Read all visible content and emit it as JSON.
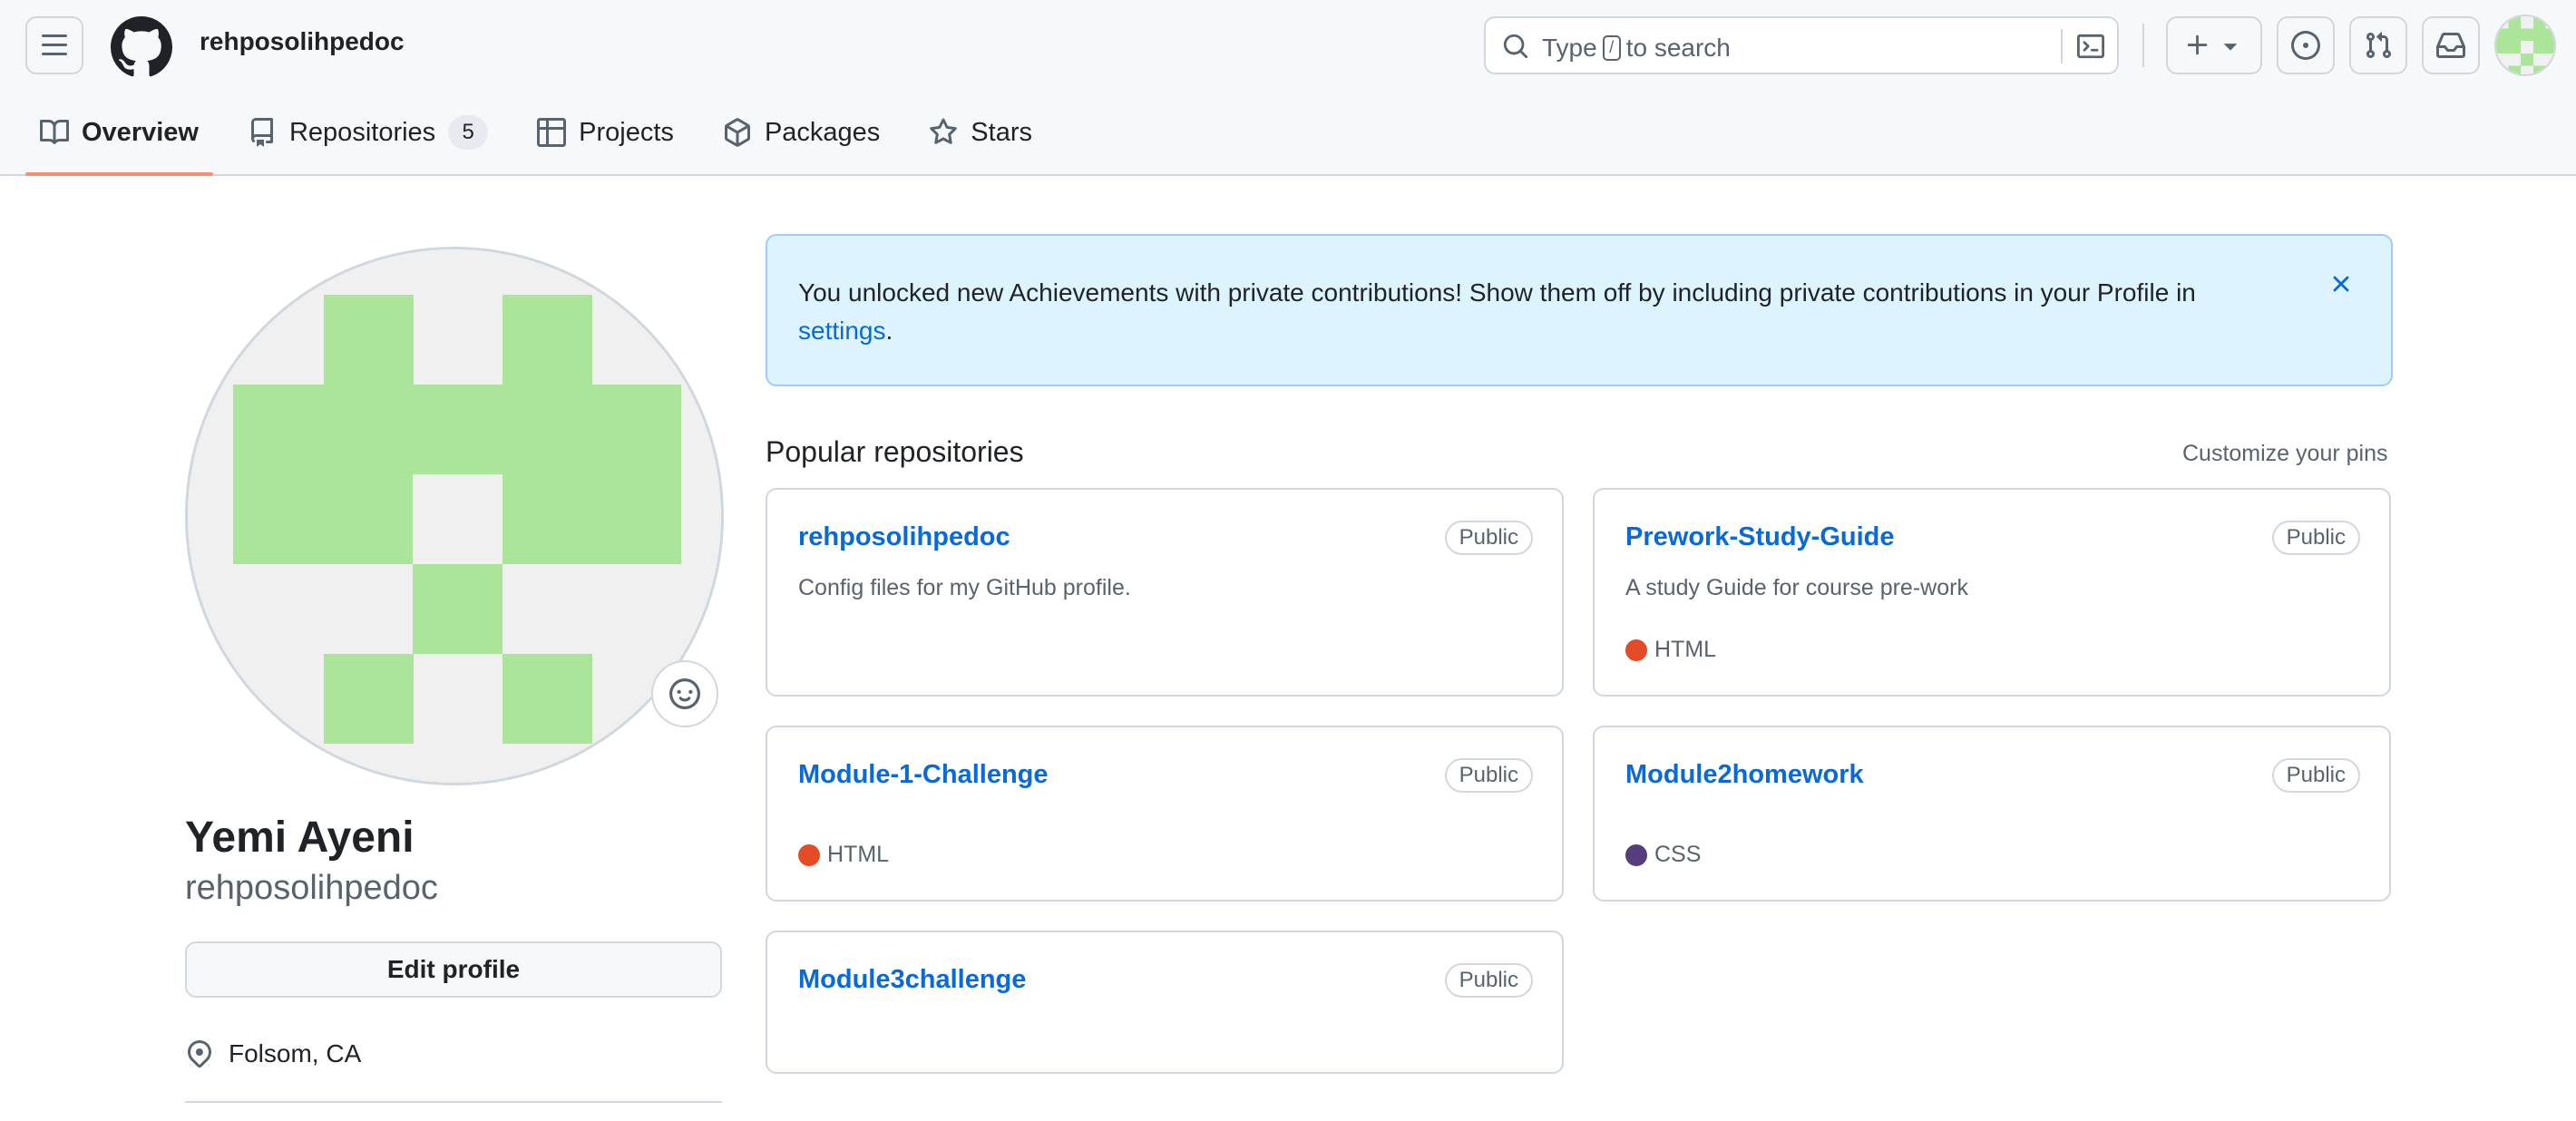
{
  "header": {
    "owner": "rehposolihpedoc",
    "search": {
      "prefix": "Type",
      "key": "/",
      "suffix": "to search"
    }
  },
  "tabs": [
    {
      "label": "Overview",
      "active": true
    },
    {
      "label": "Repositories",
      "count": "5"
    },
    {
      "label": "Projects"
    },
    {
      "label": "Packages"
    },
    {
      "label": "Stars"
    }
  ],
  "profile": {
    "full_name": "Yemi Ayeni",
    "login": "rehposolihpedoc",
    "edit_label": "Edit profile",
    "location": "Folsom, CA",
    "avatar_color": "#abe59a"
  },
  "flash": {
    "message": "You unlocked new Achievements with private contributions! Show them off by including private contributions in your Profile in",
    "link": "settings",
    "end": "."
  },
  "popular": {
    "title": "Popular repositories",
    "customize": "Customize your pins",
    "repos": [
      {
        "name": "rehposolihpedoc",
        "visibility": "Public",
        "description": "Config files for my GitHub profile.",
        "language": "",
        "lang_color": ""
      },
      {
        "name": "Prework-Study-Guide",
        "visibility": "Public",
        "description": "A study Guide for course pre-work",
        "language": "HTML",
        "lang_color": "#e34c26"
      },
      {
        "name": "Module-1-Challenge",
        "visibility": "Public",
        "description": "",
        "language": "HTML",
        "lang_color": "#e34c26"
      },
      {
        "name": "Module2homework",
        "visibility": "Public",
        "description": "",
        "language": "CSS",
        "lang_color": "#563d7c"
      },
      {
        "name": "Module3challenge",
        "visibility": "Public",
        "description": "",
        "language": "",
        "lang_color": ""
      }
    ]
  },
  "colors": {
    "accent": "#0969da",
    "tab_underline": "#fd8c73",
    "flash_bg": "#ddf4ff"
  }
}
